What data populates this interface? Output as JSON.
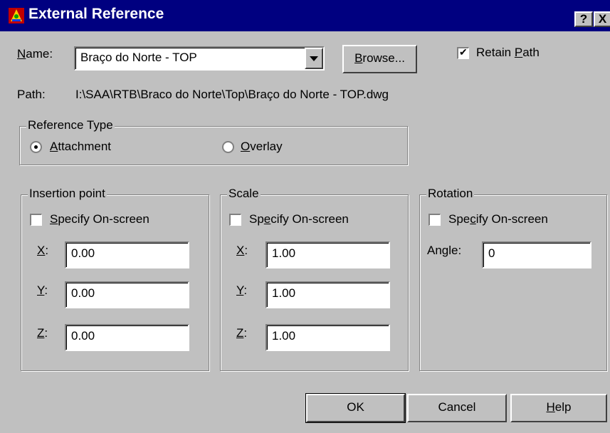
{
  "window": {
    "title": "External Reference",
    "help_button": "?",
    "close_button": "X"
  },
  "name": {
    "label_mnemonic": "N",
    "label_rest": "ame:",
    "value": "Braço do Norte - TOP"
  },
  "browse": {
    "mnemonic": "B",
    "rest": "rowse..."
  },
  "retain_path": {
    "checked": true,
    "pre": "Retain ",
    "mnemonic": "P",
    "rest": "ath"
  },
  "path": {
    "label": "Path:",
    "value": "I:\\SAA\\RTB\\Braco do Norte\\Top\\Braço do Norte - TOP.dwg"
  },
  "reference_type": {
    "title": "Reference Type",
    "attachment": {
      "mnemonic": "A",
      "rest": "ttachment",
      "selected": true
    },
    "overlay": {
      "mnemonic": "O",
      "rest": "verlay",
      "selected": false
    }
  },
  "insertion": {
    "title": "Insertion point",
    "specify": {
      "mnemonic": "S",
      "rest": "pecify On-screen"
    },
    "x_label": "X",
    "y_label": "Y",
    "z_label": "Z",
    "colon": ":",
    "x": "0.00",
    "y": "0.00",
    "z": "0.00"
  },
  "scale": {
    "title": "Scale",
    "specify": {
      "pre": "Sp",
      "mnemonic": "e",
      "rest": "cify On-screen"
    },
    "x_label": "X",
    "y_label": "Y",
    "z_label": "Z",
    "colon": ":",
    "x": "1.00",
    "y": "1.00",
    "z": "1.00"
  },
  "rotation": {
    "title": "Rotation",
    "specify": {
      "pre": "Spe",
      "mnemonic": "c",
      "rest": "ify On-screen"
    },
    "angle_label": "Angle:",
    "angle": "0"
  },
  "buttons": {
    "ok": "OK",
    "cancel": "Cancel",
    "help_mnemonic": "H",
    "help_rest": "elp"
  }
}
